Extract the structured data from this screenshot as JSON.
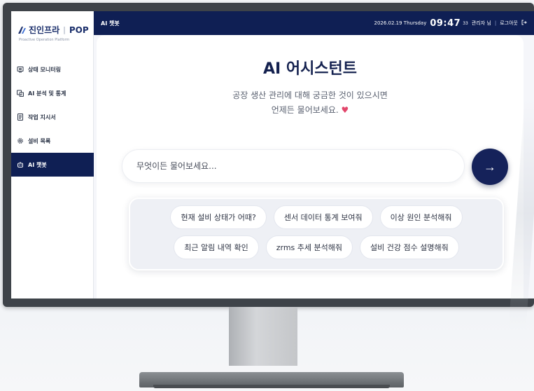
{
  "brand": {
    "name": "진인프라",
    "separator": "|",
    "product": "POP",
    "tagline": "Proactive Operation Platform"
  },
  "sidebar": {
    "items": [
      {
        "label": "상태 모니터링",
        "icon": "monitor-icon",
        "active": false
      },
      {
        "label": "AI 분석 및 통계",
        "icon": "analytics-icon",
        "active": false
      },
      {
        "label": "작업 지시서",
        "icon": "document-icon",
        "active": false
      },
      {
        "label": "설비 목록",
        "icon": "gear-icon",
        "active": false
      },
      {
        "label": "AI 챗봇",
        "icon": "bot-icon",
        "active": true
      }
    ]
  },
  "topbar": {
    "title": "AI 챗봇",
    "date": "2026.02.19 Thursday",
    "time": "09:47",
    "seconds": "33",
    "user": "관리자 님",
    "separator": "|",
    "logout": "로그아웃"
  },
  "main": {
    "title": "AI 어시스턴트",
    "subtitle_line1": "공장 생산 관리에 대해 궁금한 것이 있으시면",
    "subtitle_line2": "언제든 물어보세요.",
    "heart": "♥",
    "input_placeholder": "무엇이든 물어보세요...",
    "send_icon": "→",
    "suggestions_row1": [
      "현재 설비 상태가 어때?",
      "센서 데이터 통계 보여줘",
      "이상 원인 분석해줘"
    ],
    "suggestions_row2": [
      "최근 알림 내역 확인",
      "zrms 추세 분석해줘",
      "설비 건강 점수 설명해줘"
    ]
  },
  "colors": {
    "navy": "#0f1f54",
    "accent_heart": "#e2466b"
  }
}
